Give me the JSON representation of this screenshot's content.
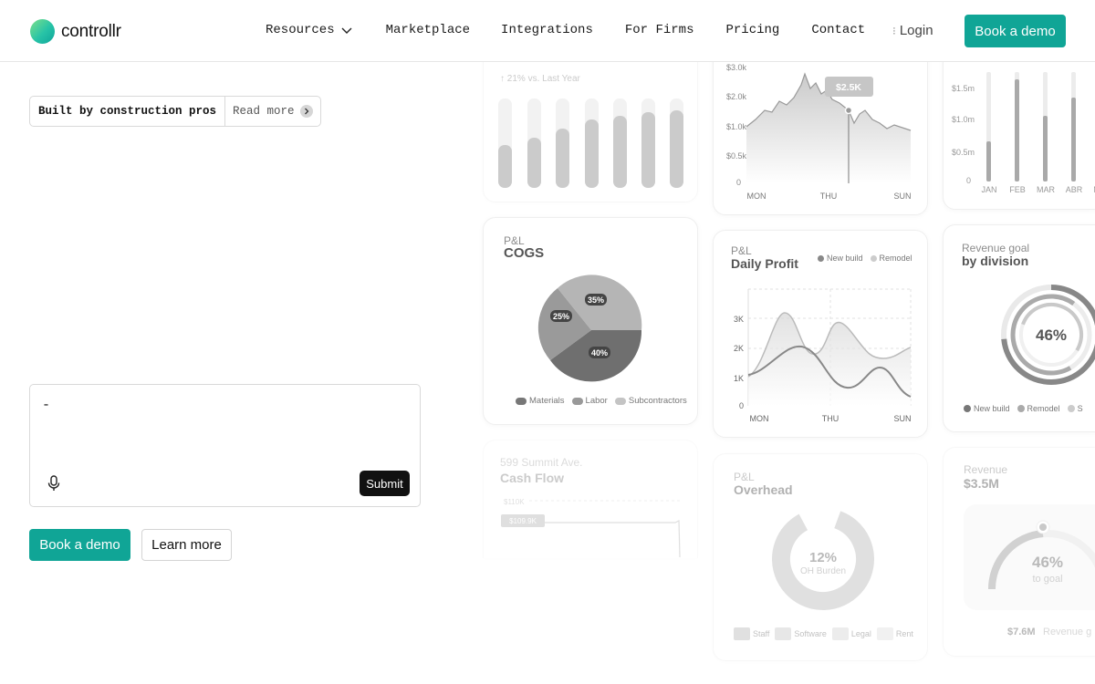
{
  "nav": {
    "brand": "controllr",
    "links": [
      "Resources",
      "Marketplace",
      "Integrations",
      "For Firms",
      "Pricing",
      "Contact"
    ],
    "login": "Login",
    "cta": "Book a demo"
  },
  "hero": {
    "badge": "Built by construction pros",
    "badge_link": "Read more",
    "prompt_value": "-",
    "submit": "Submit",
    "cta_primary": "Book a demo",
    "cta_secondary": "Learn more"
  },
  "cards": {
    "bars_top": {
      "note": "↑ 21% vs. Last Year"
    },
    "line_top": {
      "y_ticks": [
        "$3.0k",
        "$2.0k",
        "$1.0k",
        "$0.5k",
        "0"
      ],
      "x_ticks": [
        "MON",
        "THU",
        "SUN"
      ],
      "tooltip": "$2.5K"
    },
    "bars_right": {
      "y_ticks": [
        "$1.5m",
        "$1.0m",
        "$0.5m",
        "0"
      ],
      "x_ticks": [
        "JAN",
        "FEB",
        "MAR",
        "ABR",
        "M"
      ]
    },
    "cogs": {
      "label": "P&L",
      "title": "COGS",
      "slices": [
        {
          "name": "Materials",
          "pct": "25%"
        },
        {
          "name": "Labor",
          "pct": "35%"
        },
        {
          "name": "Subcontractors",
          "pct": "40%"
        }
      ]
    },
    "daily_profit": {
      "label": "P&L",
      "title": "Daily Profit",
      "legend": [
        "New build",
        "Remodel"
      ],
      "y_ticks": [
        "3K",
        "2K",
        "1K",
        "0"
      ],
      "x_ticks": [
        "MON",
        "THU",
        "SUN"
      ]
    },
    "revenue_goal": {
      "label": "Revenue goal",
      "title": "by division",
      "value": "46%",
      "legend": [
        "New build",
        "Remodel",
        "S"
      ]
    },
    "cash_flow": {
      "label": "599 Summit Ave.",
      "title": "Cash Flow",
      "y_tick": "$110K",
      "badge": "$109.9K"
    },
    "overhead": {
      "label": "P&L",
      "title": "Overhead",
      "value": "12%",
      "sub": "OH Burden",
      "legend": [
        "Staff",
        "Software",
        "Legal",
        "Rent"
      ]
    },
    "revenue": {
      "label": "Revenue",
      "title": "$3.5M",
      "value": "46%",
      "sub": "to goal",
      "foot_value": "$7.6M",
      "foot_label": "Revenue g"
    }
  },
  "colors": {
    "accent": "#10a596",
    "dark": "#111111"
  }
}
